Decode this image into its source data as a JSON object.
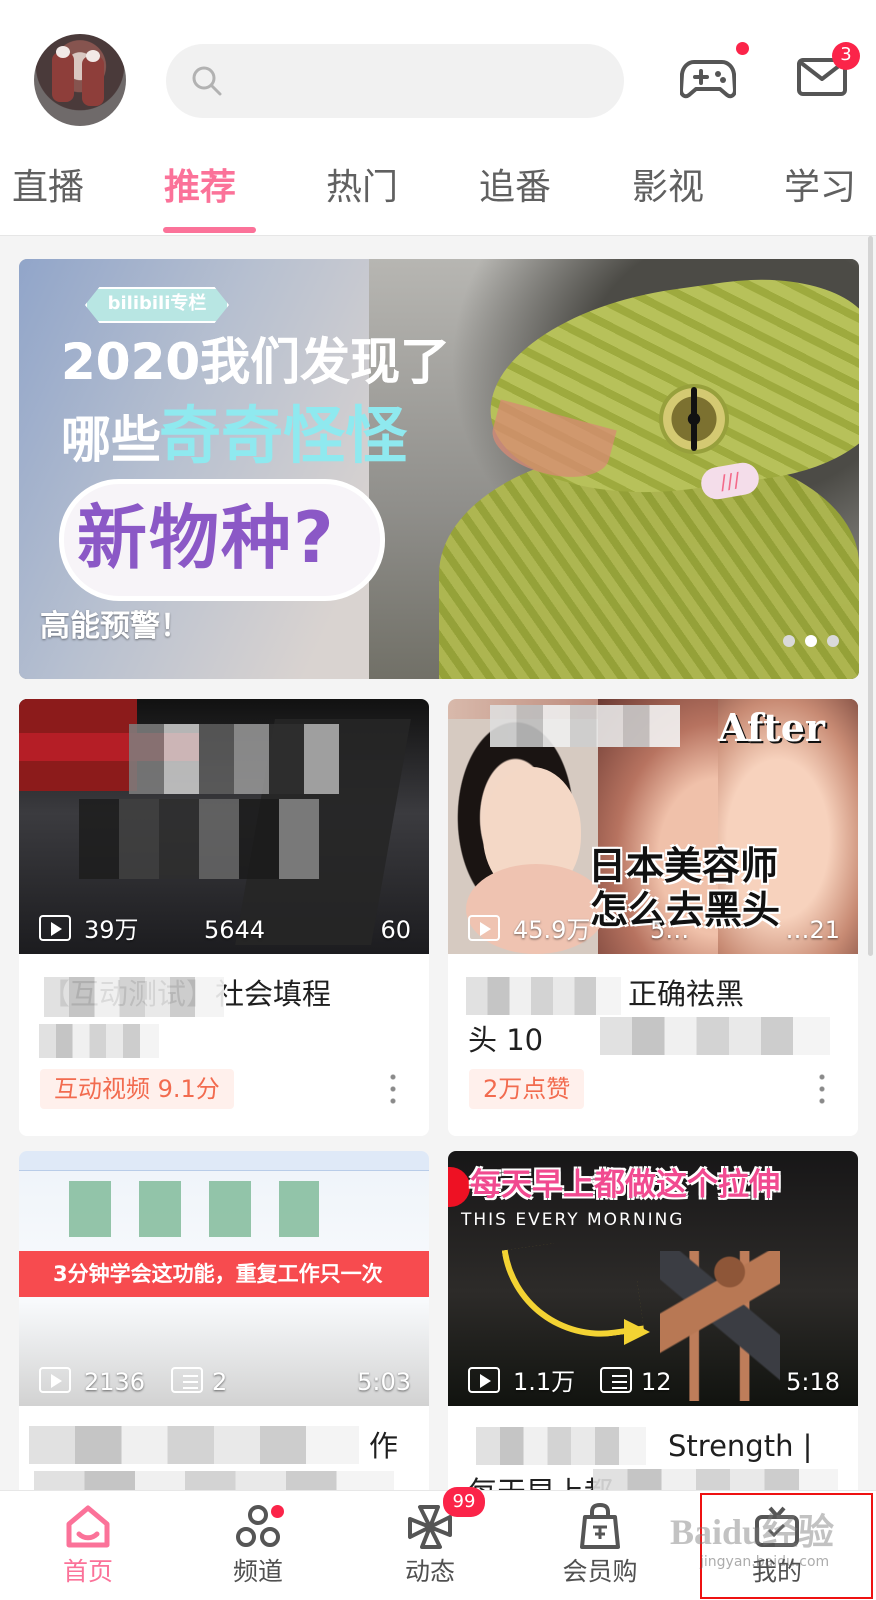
{
  "header": {
    "search_placeholder": "",
    "mail_badge": "3"
  },
  "tabs": [
    "直播",
    "推荐",
    "热门",
    "追番",
    "影视",
    "学习"
  ],
  "banner": {
    "caption": "高能预警！",
    "pill": "bilibili专栏",
    "headline_line1": "2020我们发现了",
    "headline_line2a": "哪些",
    "headline_line2b": "奇奇怪怪",
    "headline_line3": "新物种?",
    "mark": "///"
  },
  "cards": [
    {
      "views": "39万",
      "comments": "5644",
      "duration": "60",
      "title": "【互动测试】社会填程",
      "tag": "互动视频 9.1分"
    },
    {
      "views": "45.9万",
      "comments": "5…",
      "duration": "…21",
      "overlay": "After",
      "overlay_line1": "日本美容师",
      "overlay_line2": "怎么去黑头",
      "title": "正确祛黑",
      "title_line2": "头 10分",
      "tag": "2万点赞"
    },
    {
      "views": "2136",
      "comments": "2",
      "duration": "5:03",
      "overlay": "3分钟学会这功能，重复工作只一次",
      "title": "作"
    },
    {
      "views": "1.1万",
      "comments": "12",
      "duration": "5:18",
      "overlay": "每天早上都做这个拉伸",
      "overlay_english": "THIS EVERY MORNING",
      "title": "Strength | ",
      "title_line2": "每天早上都"
    }
  ],
  "nav": [
    {
      "label": "首页",
      "icon": "home-icon",
      "active": true
    },
    {
      "label": "频道",
      "icon": "channel-icon",
      "active": false
    },
    {
      "label": "动态",
      "icon": "dynamic-icon",
      "badge": "99",
      "active": false
    },
    {
      "label": "会员购",
      "icon": "shopping-bag-icon",
      "active": false
    },
    {
      "label": "我的",
      "icon": "tv-icon",
      "active": false
    }
  ],
  "colors": {
    "accent": "#fb7299",
    "badge": "#fb2449",
    "tag_text": "#f26b4f",
    "tag_bg": "#fff0ec"
  },
  "watermark": "Baidu经验",
  "watermark_url": "jingyan.baidu.com"
}
